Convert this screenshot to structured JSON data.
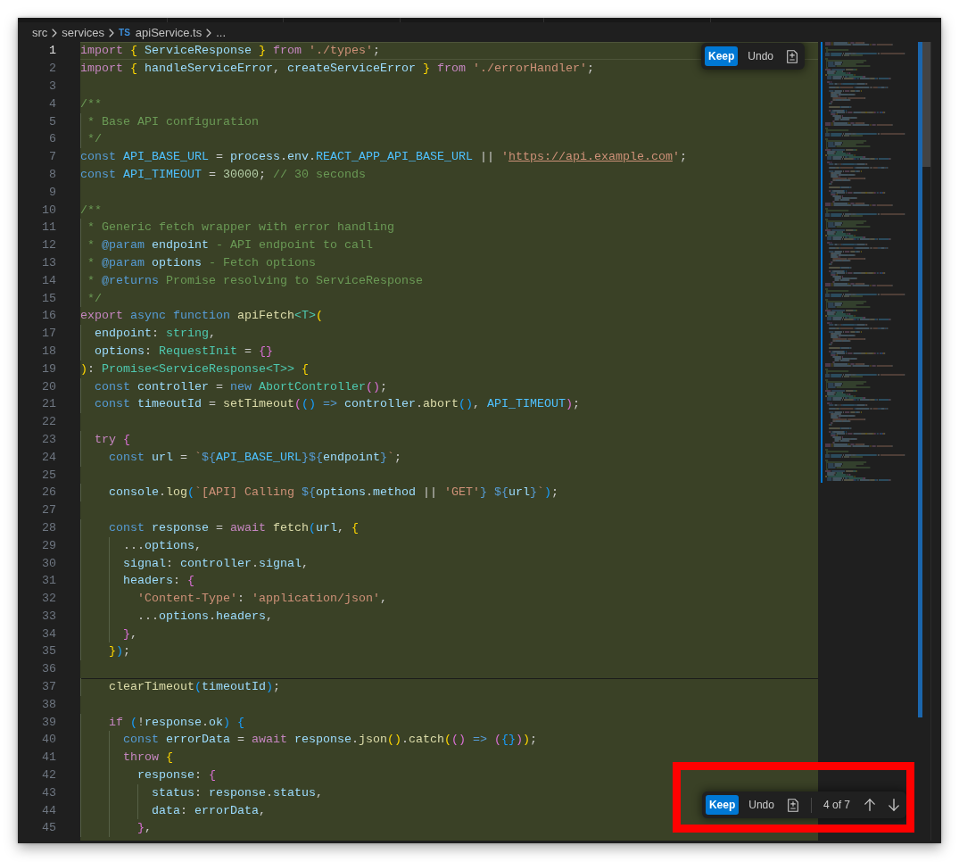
{
  "breadcrumb": [
    {
      "label": "src"
    },
    {
      "label": "services"
    },
    {
      "label": "apiService.ts",
      "file_badge": "TS"
    },
    {
      "label": "..."
    }
  ],
  "inline_actions": {
    "actions": [
      {
        "label": "Keep",
        "primary": true
      },
      {
        "label": "Undo",
        "primary": false
      }
    ]
  },
  "editor": {
    "hunks": [
      {
        "lines": [
          {
            "number": "1",
            "current": true,
            "tokens": [
              {
                "kind": "ctrl",
                "text": "import "
              },
              {
                "kind": "bracket1",
                "text": "{"
              },
              {
                "kind": "var",
                "text": " ServiceResponse "
              },
              {
                "kind": "bracket1",
                "text": "}"
              },
              {
                "kind": "ctrl",
                "text": " from "
              },
              {
                "kind": "string",
                "text": "'./types'"
              },
              {
                "kind": "plain",
                "text": ";"
              }
            ]
          },
          {
            "number": "2",
            "current": false,
            "tokens": [
              {
                "kind": "ctrl",
                "text": "import "
              },
              {
                "kind": "bracket1",
                "text": "{"
              },
              {
                "kind": "var",
                "text": " handleServiceError"
              },
              {
                "kind": "plain",
                "text": ", "
              },
              {
                "kind": "var",
                "text": "createServiceError "
              },
              {
                "kind": "bracket1",
                "text": "}"
              },
              {
                "kind": "ctrl",
                "text": " from "
              },
              {
                "kind": "string",
                "text": "'./errorHandler'"
              },
              {
                "kind": "plain",
                "text": ";"
              }
            ]
          },
          {
            "number": "3",
            "current": false
          },
          {
            "number": "4",
            "current": false,
            "tokens": [
              {
                "kind": "comment",
                "text": "/**"
              }
            ]
          },
          {
            "number": "5",
            "current": false,
            "tokens": [
              {
                "kind": "comment",
                "text": " * Base API configuration"
              }
            ]
          },
          {
            "number": "6",
            "current": false,
            "tokens": [
              {
                "kind": "comment",
                "text": " */"
              }
            ]
          },
          {
            "number": "7",
            "current": false,
            "tokens": [
              {
                "kind": "storage",
                "text": "const "
              },
              {
                "kind": "const",
                "text": "API_BASE_URL"
              },
              {
                "kind": "plain",
                "text": " = "
              },
              {
                "kind": "var",
                "text": "process"
              },
              {
                "kind": "plain",
                "text": "."
              },
              {
                "kind": "var",
                "text": "env"
              },
              {
                "kind": "plain",
                "text": "."
              },
              {
                "kind": "const",
                "text": "REACT_APP_API_BASE_URL"
              },
              {
                "kind": "plain",
                "text": " || "
              },
              {
                "kind": "string",
                "text": "'"
              },
              {
                "kind": "link",
                "text": "https://api.example.com"
              },
              {
                "kind": "string",
                "text": "'"
              },
              {
                "kind": "plain",
                "text": ";"
              }
            ]
          },
          {
            "number": "8",
            "current": false,
            "tokens": [
              {
                "kind": "storage",
                "text": "const "
              },
              {
                "kind": "const",
                "text": "API_TIMEOUT"
              },
              {
                "kind": "plain",
                "text": " = "
              },
              {
                "kind": "number",
                "text": "30000"
              },
              {
                "kind": "plain",
                "text": "; "
              },
              {
                "kind": "comment",
                "text": "// 30 seconds"
              }
            ]
          },
          {
            "number": "9",
            "current": false
          },
          {
            "number": "10",
            "current": false,
            "tokens": [
              {
                "kind": "comment",
                "text": "/**"
              }
            ]
          },
          {
            "number": "11",
            "current": false,
            "tokens": [
              {
                "kind": "comment",
                "text": " * Generic fetch wrapper with error handling"
              }
            ]
          },
          {
            "number": "12",
            "current": false,
            "tokens": [
              {
                "kind": "comment",
                "text": " * "
              },
              {
                "kind": "doctag",
                "text": "@param"
              },
              {
                "kind": "var",
                "text": " endpoint"
              },
              {
                "kind": "comment",
                "text": " - API endpoint to call"
              }
            ]
          },
          {
            "number": "13",
            "current": false,
            "tokens": [
              {
                "kind": "comment",
                "text": " * "
              },
              {
                "kind": "doctag",
                "text": "@param"
              },
              {
                "kind": "var",
                "text": " options"
              },
              {
                "kind": "comment",
                "text": " - Fetch options"
              }
            ]
          },
          {
            "number": "14",
            "current": false,
            "tokens": [
              {
                "kind": "comment",
                "text": " * "
              },
              {
                "kind": "doctag",
                "text": "@returns"
              },
              {
                "kind": "comment",
                "text": " Promise resolving to ServiceResponse"
              }
            ]
          },
          {
            "number": "15",
            "current": false,
            "tokens": [
              {
                "kind": "comment",
                "text": " */"
              }
            ]
          },
          {
            "number": "16",
            "current": false,
            "tokens": [
              {
                "kind": "ctrl",
                "text": "export "
              },
              {
                "kind": "storage",
                "text": "async function "
              },
              {
                "kind": "func",
                "text": "apiFetch"
              },
              {
                "kind": "type",
                "text": "<T>"
              },
              {
                "kind": "bracket1",
                "text": "("
              }
            ]
          },
          {
            "number": "17",
            "current": false,
            "tokens": [
              {
                "kind": "var",
                "text": "  endpoint"
              },
              {
                "kind": "plain",
                "text": ": "
              },
              {
                "kind": "type",
                "text": "string"
              },
              {
                "kind": "plain",
                "text": ","
              }
            ]
          },
          {
            "number": "18",
            "current": false,
            "tokens": [
              {
                "kind": "var",
                "text": "  options"
              },
              {
                "kind": "plain",
                "text": ": "
              },
              {
                "kind": "type",
                "text": "RequestInit"
              },
              {
                "kind": "plain",
                "text": " = "
              },
              {
                "kind": "bracket2",
                "text": "{}"
              }
            ]
          },
          {
            "number": "19",
            "current": false,
            "tokens": [
              {
                "kind": "bracket1",
                "text": ")"
              },
              {
                "kind": "plain",
                "text": ": "
              },
              {
                "kind": "type",
                "text": "Promise<ServiceResponse<T>> "
              },
              {
                "kind": "bracket1",
                "text": "{"
              }
            ]
          },
          {
            "number": "20",
            "current": false,
            "tokens": [
              {
                "kind": "storage",
                "text": "  const "
              },
              {
                "kind": "var",
                "text": "controller"
              },
              {
                "kind": "plain",
                "text": " = "
              },
              {
                "kind": "storage",
                "text": "new "
              },
              {
                "kind": "type",
                "text": "AbortController"
              },
              {
                "kind": "bracket2",
                "text": "()"
              },
              {
                "kind": "plain",
                "text": ";"
              }
            ]
          },
          {
            "number": "21",
            "current": false,
            "tokens": [
              {
                "kind": "storage",
                "text": "  const "
              },
              {
                "kind": "var",
                "text": "timeoutId"
              },
              {
                "kind": "plain",
                "text": " = "
              },
              {
                "kind": "func",
                "text": "setTimeout"
              },
              {
                "kind": "bracket2",
                "text": "("
              },
              {
                "kind": "bracket3",
                "text": "()"
              },
              {
                "kind": "storage",
                "text": " => "
              },
              {
                "kind": "var",
                "text": "controller"
              },
              {
                "kind": "plain",
                "text": "."
              },
              {
                "kind": "func",
                "text": "abort"
              },
              {
                "kind": "bracket3",
                "text": "()"
              },
              {
                "kind": "plain",
                "text": ", "
              },
              {
                "kind": "const",
                "text": "API_TIMEOUT"
              },
              {
                "kind": "bracket2",
                "text": ")"
              },
              {
                "kind": "plain",
                "text": ";"
              }
            ]
          },
          {
            "number": "22",
            "current": false
          },
          {
            "number": "23",
            "current": false,
            "tokens": [
              {
                "kind": "ctrl",
                "text": "  try "
              },
              {
                "kind": "bracket2",
                "text": "{"
              }
            ]
          },
          {
            "number": "24",
            "current": false,
            "tokens": [
              {
                "kind": "storage",
                "text": "    const "
              },
              {
                "kind": "var",
                "text": "url"
              },
              {
                "kind": "plain",
                "text": " = "
              },
              {
                "kind": "string",
                "text": "`"
              },
              {
                "kind": "storage",
                "text": "${"
              },
              {
                "kind": "const",
                "text": "API_BASE_URL"
              },
              {
                "kind": "storage",
                "text": "}${"
              },
              {
                "kind": "var",
                "text": "endpoint"
              },
              {
                "kind": "storage",
                "text": "}"
              },
              {
                "kind": "string",
                "text": "`"
              },
              {
                "kind": "plain",
                "text": ";"
              }
            ]
          },
          {
            "number": "25",
            "current": false
          },
          {
            "number": "26",
            "current": false,
            "tokens": [
              {
                "kind": "var",
                "text": "    console"
              },
              {
                "kind": "plain",
                "text": "."
              },
              {
                "kind": "func",
                "text": "log"
              },
              {
                "kind": "bracket3",
                "text": "("
              },
              {
                "kind": "string",
                "text": "`[API] Calling "
              },
              {
                "kind": "storage",
                "text": "${"
              },
              {
                "kind": "var",
                "text": "options"
              },
              {
                "kind": "plain",
                "text": "."
              },
              {
                "kind": "var",
                "text": "method"
              },
              {
                "kind": "plain",
                "text": " || "
              },
              {
                "kind": "string",
                "text": "'GET'"
              },
              {
                "kind": "storage",
                "text": "} ${"
              },
              {
                "kind": "var",
                "text": "url"
              },
              {
                "kind": "storage",
                "text": "}"
              },
              {
                "kind": "string",
                "text": "`"
              },
              {
                "kind": "bracket3",
                "text": ")"
              },
              {
                "kind": "plain",
                "text": ";"
              }
            ]
          },
          {
            "number": "27",
            "current": false
          },
          {
            "number": "28",
            "current": false,
            "tokens": [
              {
                "kind": "storage",
                "text": "    const "
              },
              {
                "kind": "var",
                "text": "response"
              },
              {
                "kind": "plain",
                "text": " = "
              },
              {
                "kind": "ctrl",
                "text": "await "
              },
              {
                "kind": "func",
                "text": "fetch"
              },
              {
                "kind": "bracket3",
                "text": "("
              },
              {
                "kind": "var",
                "text": "url"
              },
              {
                "kind": "plain",
                "text": ", "
              },
              {
                "kind": "bracket1",
                "text": "{"
              }
            ]
          },
          {
            "number": "29",
            "current": false,
            "tokens": [
              {
                "kind": "plain",
                "text": "      ..."
              },
              {
                "kind": "var",
                "text": "options"
              },
              {
                "kind": "plain",
                "text": ","
              }
            ]
          },
          {
            "number": "30",
            "current": false,
            "tokens": [
              {
                "kind": "var",
                "text": "      signal"
              },
              {
                "kind": "plain",
                "text": ": "
              },
              {
                "kind": "var",
                "text": "controller"
              },
              {
                "kind": "plain",
                "text": "."
              },
              {
                "kind": "var",
                "text": "signal"
              },
              {
                "kind": "plain",
                "text": ","
              }
            ]
          },
          {
            "number": "31",
            "current": false,
            "tokens": [
              {
                "kind": "var",
                "text": "      headers"
              },
              {
                "kind": "plain",
                "text": ": "
              },
              {
                "kind": "bracket2",
                "text": "{"
              }
            ]
          },
          {
            "number": "32",
            "current": false,
            "tokens": [
              {
                "kind": "string",
                "text": "        'Content-Type'"
              },
              {
                "kind": "plain",
                "text": ": "
              },
              {
                "kind": "string",
                "text": "'application/json'"
              },
              {
                "kind": "plain",
                "text": ","
              }
            ]
          },
          {
            "number": "33",
            "current": false,
            "tokens": [
              {
                "kind": "plain",
                "text": "        ..."
              },
              {
                "kind": "var",
                "text": "options"
              },
              {
                "kind": "plain",
                "text": "."
              },
              {
                "kind": "var",
                "text": "headers"
              },
              {
                "kind": "plain",
                "text": ","
              }
            ]
          },
          {
            "number": "34",
            "current": false,
            "tokens": [
              {
                "kind": "bracket2",
                "text": "      }"
              },
              {
                "kind": "plain",
                "text": ","
              }
            ]
          },
          {
            "number": "35",
            "current": false,
            "tokens": [
              {
                "kind": "bracket1",
                "text": "    }"
              },
              {
                "kind": "bracket3",
                "text": ")"
              },
              {
                "kind": "plain",
                "text": ";"
              }
            ]
          },
          {
            "number": "36",
            "current": false
          }
        ]
      },
      {
        "lines": [
          {
            "number": "37",
            "current": false,
            "tokens": [
              {
                "kind": "func",
                "text": "    clearTimeout"
              },
              {
                "kind": "bracket3",
                "text": "("
              },
              {
                "kind": "var",
                "text": "timeoutId"
              },
              {
                "kind": "bracket3",
                "text": ")"
              },
              {
                "kind": "plain",
                "text": ";"
              }
            ]
          },
          {
            "number": "38",
            "current": false
          },
          {
            "number": "39",
            "current": false,
            "tokens": [
              {
                "kind": "ctrl",
                "text": "    if "
              },
              {
                "kind": "bracket3",
                "text": "("
              },
              {
                "kind": "plain",
                "text": "!"
              },
              {
                "kind": "var",
                "text": "response"
              },
              {
                "kind": "plain",
                "text": "."
              },
              {
                "kind": "var",
                "text": "ok"
              },
              {
                "kind": "bracket3",
                "text": ")"
              },
              {
                "kind": "bracket3",
                "text": " {"
              }
            ]
          },
          {
            "number": "40",
            "current": false,
            "tokens": [
              {
                "kind": "storage",
                "text": "      const "
              },
              {
                "kind": "var",
                "text": "errorData"
              },
              {
                "kind": "plain",
                "text": " = "
              },
              {
                "kind": "ctrl",
                "text": "await "
              },
              {
                "kind": "var",
                "text": "response"
              },
              {
                "kind": "plain",
                "text": "."
              },
              {
                "kind": "func",
                "text": "json"
              },
              {
                "kind": "bracket1",
                "text": "()"
              },
              {
                "kind": "plain",
                "text": "."
              },
              {
                "kind": "func",
                "text": "catch"
              },
              {
                "kind": "bracket1",
                "text": "("
              },
              {
                "kind": "bracket2",
                "text": "()"
              },
              {
                "kind": "storage",
                "text": " => "
              },
              {
                "kind": "bracket2",
                "text": "("
              },
              {
                "kind": "bracket3",
                "text": "{}"
              },
              {
                "kind": "bracket2",
                "text": ")"
              },
              {
                "kind": "bracket1",
                "text": ")"
              },
              {
                "kind": "plain",
                "text": ";"
              }
            ]
          },
          {
            "number": "41",
            "current": false,
            "tokens": [
              {
                "kind": "ctrl",
                "text": "      throw "
              },
              {
                "kind": "bracket1",
                "text": "{"
              }
            ]
          },
          {
            "number": "42",
            "current": false,
            "tokens": [
              {
                "kind": "var",
                "text": "        response"
              },
              {
                "kind": "plain",
                "text": ": "
              },
              {
                "kind": "bracket2",
                "text": "{"
              }
            ]
          },
          {
            "number": "43",
            "current": false,
            "tokens": [
              {
                "kind": "var",
                "text": "          status"
              },
              {
                "kind": "plain",
                "text": ": "
              },
              {
                "kind": "var",
                "text": "response"
              },
              {
                "kind": "plain",
                "text": "."
              },
              {
                "kind": "var",
                "text": "status"
              },
              {
                "kind": "plain",
                "text": ","
              }
            ]
          },
          {
            "number": "44",
            "current": false,
            "tokens": [
              {
                "kind": "var",
                "text": "          data"
              },
              {
                "kind": "plain",
                "text": ": "
              },
              {
                "kind": "var",
                "text": "errorData"
              },
              {
                "kind": "plain",
                "text": ","
              }
            ]
          },
          {
            "number": "45",
            "current": false,
            "tokens": [
              {
                "kind": "bracket2",
                "text": "        }"
              },
              {
                "kind": "plain",
                "text": ","
              }
            ]
          }
        ]
      }
    ]
  },
  "review_bar": {
    "highlighted": true,
    "actions": [
      {
        "label": "Keep",
        "primary": true
      },
      {
        "label": "Undo",
        "primary": false
      }
    ],
    "counter": "4 of 7"
  }
}
